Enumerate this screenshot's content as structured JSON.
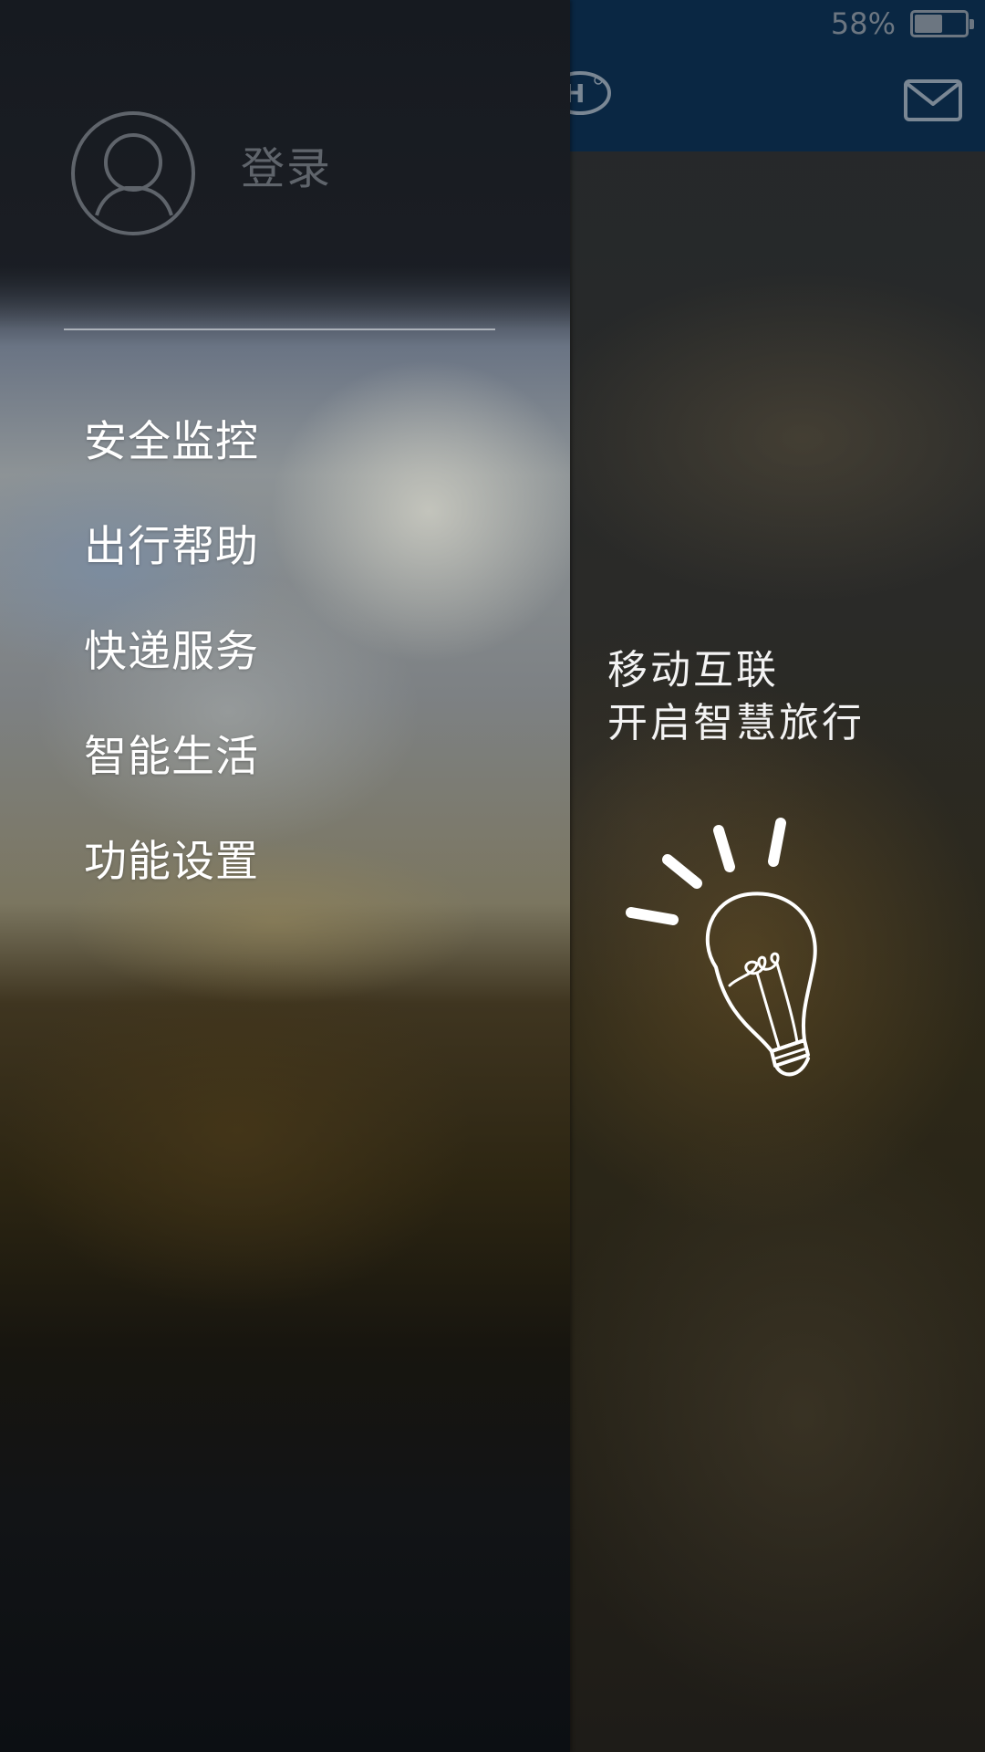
{
  "status_bar": {
    "battery_percent_text": "58%",
    "battery_level": 0.58
  },
  "header": {
    "logo_icon": "brand-logo-icon",
    "mail_icon": "mail-icon"
  },
  "drawer": {
    "avatar_icon": "user-avatar-icon",
    "login_label": "登录",
    "menu": [
      {
        "label": "安全监控"
      },
      {
        "label": "出行帮助"
      },
      {
        "label": "快递服务"
      },
      {
        "label": "智能生活"
      },
      {
        "label": "功能设置"
      }
    ]
  },
  "main": {
    "slogan_line1": "移动互联",
    "slogan_line2": "开启智慧旅行",
    "illustration_icon": "lightbulb-icon"
  },
  "colors": {
    "header_bg": "#0a2743",
    "menu_text": "#ffffff",
    "login_text": "#5f646b"
  }
}
